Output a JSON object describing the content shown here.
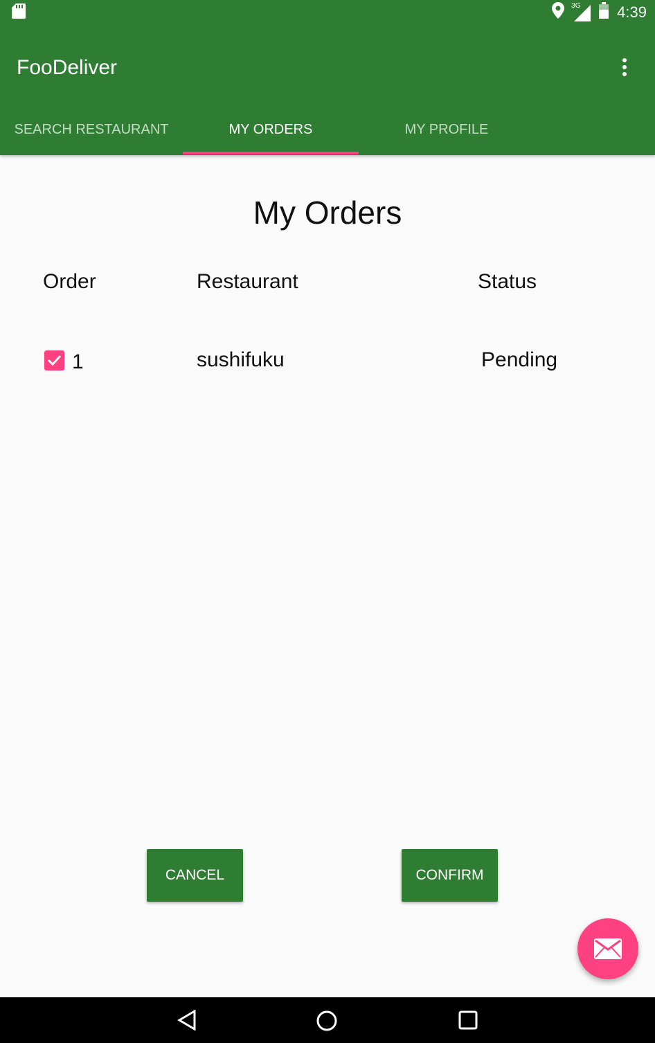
{
  "status_bar": {
    "time": "4:39",
    "network_label": "3G",
    "icons": [
      "sd-card-icon",
      "location-icon",
      "signal-icon",
      "battery-icon"
    ]
  },
  "app_bar": {
    "title": "FooDeliver",
    "menu_icon": "more-vert-icon"
  },
  "tabs": [
    {
      "label": "SEARCH RESTAURANT",
      "selected": false
    },
    {
      "label": "MY ORDERS",
      "selected": true
    },
    {
      "label": "MY PROFILE",
      "selected": false
    }
  ],
  "main": {
    "title": "My Orders",
    "columns": [
      "Order",
      "Restaurant",
      "Status"
    ],
    "rows": [
      {
        "order": "1",
        "restaurant": "sushifuku",
        "status": "Pending",
        "checked": true
      }
    ]
  },
  "actions": {
    "cancel_label": "CANCEL",
    "confirm_label": "CONFIRM"
  },
  "fab": {
    "icon": "mail-icon"
  },
  "nav": {
    "icons": [
      "back-icon",
      "home-icon",
      "recents-icon"
    ]
  },
  "colors": {
    "primary": "#2e7d32",
    "accent": "#ff4081"
  }
}
